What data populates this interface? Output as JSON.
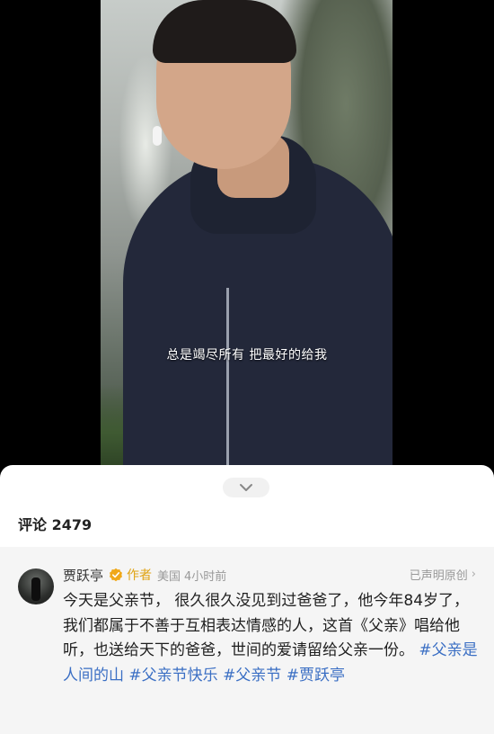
{
  "video": {
    "subtitle": "总是竭尽所有 把最好的给我"
  },
  "comments": {
    "header_label": "评论",
    "count": "2479"
  },
  "comment": {
    "author": "贾跃亭",
    "author_tag": "作者",
    "location": "美国",
    "time": "4小时前",
    "declared": "已声明原创",
    "text": "今天是父亲节， 很久很久没见到过爸爸了，他今年84岁了，我们都属于不善于互相表达情感的人，这首《父亲》唱给他听，也送给天下的爸爸，世间的爱请留给父亲一份。",
    "hashtags": [
      "#父亲是人间的山",
      "#父亲节快乐",
      "#父亲节",
      "#贾跃亭"
    ]
  },
  "colors": {
    "hashtag": "#3b6fc4",
    "author_tag": "#e0a313",
    "verified_badge": "#f0a818"
  },
  "icons": {
    "collapse": "chevron-down-icon",
    "verified": "verified-badge-icon",
    "declared_arrow": "chevron-right-icon"
  }
}
